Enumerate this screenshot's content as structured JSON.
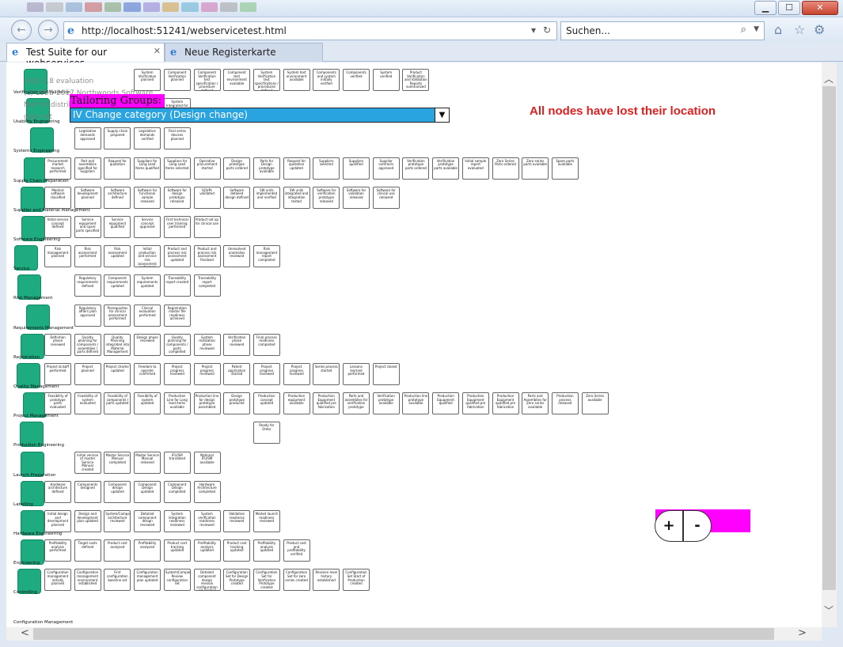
{
  "browser": {
    "url": "http://localhost:51241/webservicetest.html",
    "search_placeholder": "Suchen...",
    "tabs": [
      {
        "label": "Test Suite for our webservices",
        "active": true
      },
      {
        "label": "Neue Registerkarte",
        "active": false
      }
    ],
    "window_buttons": {
      "minimize": "▁",
      "maximize": "☐",
      "close": "✕"
    }
  },
  "page": {
    "watermark": [
      "GoJS 1.8 evaluation",
      "(c) 1998-2017 Northwoods Software",
      "Not for distribution or production use",
      "gojs.net"
    ],
    "tailoring_label": "Tailoring Groups:",
    "select_value": "IV Change category (Design change)",
    "alert_text": "All nodes have lost their location",
    "zoom_in_label": "+",
    "zoom_out_label": "-",
    "lanes": [
      {
        "label": "Verification and Validation",
        "nodes": [
          "System Verification planned",
          "Component Verification planned",
          "Component Verification test specification / procedure defined",
          "Component test environment available",
          "System Verification test specifications / procedures defined",
          "System test environment available",
          "Components and system initially verified",
          "Components verified",
          "System verified",
          "Product Verification and Validation Reports summarized"
        ]
      },
      {
        "label": "Usability Engineering",
        "nodes": [
          "System Integrated for Design Prototype",
          "System Integrated for Verification Prototype"
        ]
      },
      {
        "label": "Systems Engineering",
        "nodes": [
          "Legislative demands approved",
          "Supply chain prepared",
          "Legislative demands verified",
          "Final series devices planned"
        ]
      },
      {
        "label": "Supply Chain Preparation",
        "nodes": [
          "Procurement market research performed",
          "Part and assemblies specified for Suppliers",
          "Request for quotation",
          "Suppliers for Long Lead Items qualified",
          "Suppliers for Long Lead Items selected",
          "Operative procurement started",
          "Design prototype parts ordered",
          "Parts for Design prototype available",
          "Request for quotation updated",
          "Suppliers selected",
          "Suppliers qualified",
          "Supplier contracts approved",
          "Verification prototype parts ordered",
          "Verification prototype parts available",
          "Initial sample report evaluated",
          "Zero Series Parts ordered",
          "Zero series parts available",
          "Spare parts available"
        ]
      },
      {
        "label": "Supplier and Material Management",
        "nodes": [
          "Medical software classified",
          "Software development planned",
          "Software architecture defined",
          "Software for functional sample released",
          "Software for design prototype released",
          "SOUPs validated",
          "Software detailed design defined",
          "SW units implemented and verified",
          "SW units integrated and integration tested",
          "Software for verification prototype released",
          "Software for validation released",
          "Software for clinical use released"
        ]
      },
      {
        "label": "Software Engineering",
        "nodes": [
          "Initial service concept defined",
          "Service equipment and spare parts specified",
          "Service equipment qualified",
          "Service concept approved",
          "First technical user training performed",
          "Product set up for clinical use"
        ]
      },
      {
        "label": "Service",
        "nodes": [
          "Risk management planned",
          "Risk assessment performed",
          "Risk assessment updated",
          "Initial production and service risk assessment performed",
          "Product and process risk assessment updated",
          "Product and process risk assessment finalized",
          "Unresolved anomalies reviewed",
          "Risk management report completed"
        ]
      },
      {
        "label": "Risk Management",
        "nodes": [
          "Regulatory requirements defined",
          "Component requirements updated",
          "System requirements updated",
          "Traceability report created",
          "Traceability report completed"
        ]
      },
      {
        "label": "Requirements Management",
        "nodes": [
          "Regulatory affairs plan approved",
          "Prerequisites for clinical assessment performed",
          "Clinical evaluation performed",
          "Registration master file readiness achieved"
        ]
      },
      {
        "label": "Registration",
        "nodes": [
          "Definition phase reviewed",
          "Quality planning for components / assemblies / parts defined",
          "Quality Planning integrated into Material Management",
          "Design phase reviewed",
          "Quality planning for components / parts completed",
          "System realization phase reviewed",
          "Verification phase reviewed",
          "Final process readiness completed"
        ]
      },
      {
        "label": "Quality Management",
        "nodes": [
          "Project kickoff performed",
          "Project planned",
          "Project charter updated",
          "Freedom to operate confirmed",
          "Project progress reviewed",
          "Project progress reviewed",
          "Patent application started",
          "Project progress reviewed",
          "Project progress reviewed",
          "Series process started",
          "Lessons learned performed",
          "Project closed"
        ]
      },
      {
        "label": "Project Management",
        "nodes": [
          "Feasibility of prototype parts evaluated",
          "Feasibility of system evaluated",
          "Feasibility of components / parts updated",
          "Feasibility of system updated",
          "Production Line for Long lead items available",
          "Production line for design prototype assembled",
          "Design prototype produced",
          "Production concept updated",
          "Production equipment available",
          "Production Equipment qualified pre fabrication",
          "Parts and assemblies for verification prototype",
          "Verification prototype available",
          "Production line prototype available",
          "Production Equipment qualified",
          "Production Equipment qualified pre fabrication",
          "Production Equipment qualified pre fabrication",
          "Parts and Assemblies for Zero series available",
          "Production process released",
          "Zero Series available"
        ]
      },
      {
        "label": "Production Engineering",
        "nodes": [
          "Ready for Order"
        ]
      },
      {
        "label": "Launch Preparation",
        "nodes": [
          "Initial version of master Service Manual created",
          "Master Service Manual completed",
          "Master Service Manual released",
          "IFU/SM translated",
          "National IFU/SM available"
        ]
      },
      {
        "label": "Labelling",
        "nodes": [
          "Hardware architecture defined",
          "Components designed",
          "Component design updated",
          "Component Design updated",
          "Component Design completed",
          "Hardware Architecture completed"
        ]
      },
      {
        "label": "Hardware Engineering",
        "nodes": [
          "Initial design and development planned",
          "Design and development plan updated",
          "System/Component architecture reviewed",
          "Detailed component design reviewed",
          "System integration readiness reviewed",
          "System verification readiness reviewed",
          "Validation readiness reviewed",
          "Market launch readiness reviewed"
        ]
      },
      {
        "label": "Engineering",
        "nodes": [
          "Profitability analysis performed",
          "Target costs defined",
          "Product cost analysed",
          "Profitability analysed",
          "Product cost tracking updated",
          "Profitability analysis updated",
          "Product cost tracking updated",
          "Profitability analysis updated",
          "Product cost and profitability verified"
        ]
      },
      {
        "label": "Controlling",
        "nodes": [
          "Configuration management initially planned",
          "Configuration management environment established",
          "First configuration baseline set",
          "Configuration management plan updated",
          "System/Component Review configuration set",
          "Detailed component design revision configuration set created",
          "Configuration Set for Design Prototype created",
          "Configuration Set for Verification Prototype created",
          "Configuration Set for zero series created",
          "Revision level history established",
          "Configuration Set Start of Production created"
        ]
      },
      {
        "label": "Configuration Management",
        "nodes": []
      }
    ]
  }
}
